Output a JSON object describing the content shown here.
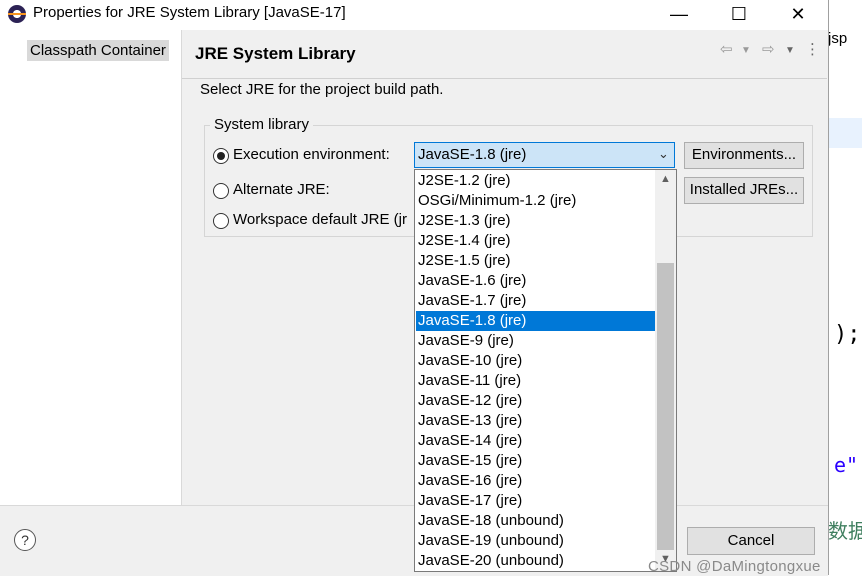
{
  "window": {
    "title": "Properties for JRE System Library [JavaSE-17]",
    "minimize_glyph": "—",
    "maximize_glyph": "☐",
    "close_glyph": "✕"
  },
  "sidebar": {
    "items": [
      {
        "label": "Classpath Container",
        "selected": true
      }
    ]
  },
  "page": {
    "title": "JRE System Library",
    "description": "Select JRE for the project build path."
  },
  "system_library": {
    "group_label": "System library",
    "options": [
      {
        "label": "Execution environment:",
        "checked": true
      },
      {
        "label": "Alternate JRE:",
        "checked": false
      },
      {
        "label": "Workspace default JRE (jr",
        "checked": false
      }
    ],
    "selected_environment": "JavaSE-1.8 (jre)",
    "environments_button": "Environments...",
    "installed_jres_button": "Installed JREs..."
  },
  "dropdown": {
    "selected_index": 7,
    "items": [
      "J2SE-1.2 (jre)",
      "OSGi/Minimum-1.2 (jre)",
      "J2SE-1.3 (jre)",
      "J2SE-1.4 (jre)",
      "J2SE-1.5 (jre)",
      "JavaSE-1.6 (jre)",
      "JavaSE-1.7 (jre)",
      "JavaSE-1.8 (jre)",
      "JavaSE-9 (jre)",
      "JavaSE-10 (jre)",
      "JavaSE-11 (jre)",
      "JavaSE-12 (jre)",
      "JavaSE-13 (jre)",
      "JavaSE-14 (jre)",
      "JavaSE-15 (jre)",
      "JavaSE-16 (jre)",
      "JavaSE-17 (jre)",
      "JavaSE-18 (unbound)",
      "JavaSE-19 (unbound)",
      "JavaSE-20 (unbound)"
    ]
  },
  "footer": {
    "help_glyph": "?",
    "cancel_label": "Cancel"
  },
  "background_editor": {
    "tab_text": "jsp",
    "code_1": ");",
    "code_2": "e\"",
    "code_3": "数据"
  },
  "watermark": "CSDN @DaMingtongxue",
  "colors": {
    "selection": "#0078d7",
    "combo_fill": "#cce4f7",
    "dialog_bg": "#f0f0f0"
  }
}
